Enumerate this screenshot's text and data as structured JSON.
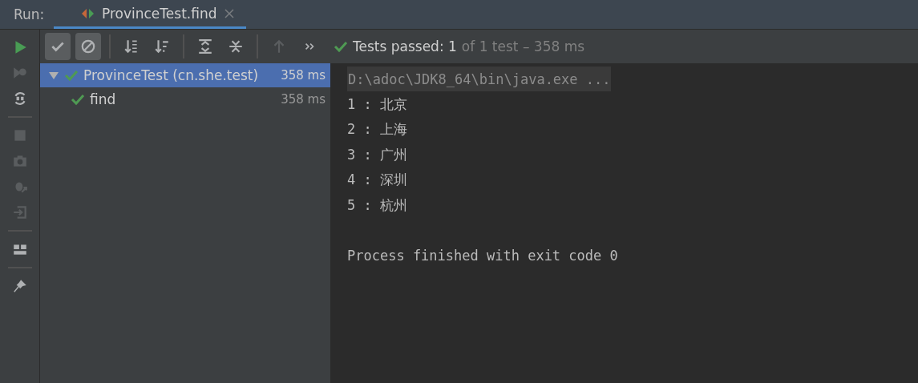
{
  "header": {
    "label": "Run:",
    "tabs": [
      {
        "title": "ProvinceTest.find",
        "selected": true
      }
    ]
  },
  "side_tools": [
    {
      "kind": "run",
      "disabled": false
    },
    {
      "kind": "rerun-failed",
      "disabled": true
    },
    {
      "kind": "toggle-auto",
      "disabled": false
    },
    {
      "kind": "sep"
    },
    {
      "kind": "stop",
      "disabled": true
    },
    {
      "kind": "camera",
      "disabled": true
    },
    {
      "kind": "debug",
      "disabled": true
    },
    {
      "kind": "exit",
      "disabled": true
    },
    {
      "kind": "sep"
    },
    {
      "kind": "layout",
      "disabled": false
    },
    {
      "kind": "sep"
    },
    {
      "kind": "pin",
      "disabled": false
    }
  ],
  "toolbar": [
    {
      "kind": "check",
      "selected": true
    },
    {
      "kind": "ignored",
      "selected": true
    },
    {
      "kind": "sep"
    },
    {
      "kind": "sort-alpha",
      "selected": false
    },
    {
      "kind": "sort-duration",
      "selected": false
    },
    {
      "kind": "sep"
    },
    {
      "kind": "expand",
      "selected": false
    },
    {
      "kind": "collapse",
      "selected": false
    },
    {
      "kind": "sep"
    },
    {
      "kind": "up",
      "selected": false
    },
    {
      "kind": "more",
      "selected": false
    }
  ],
  "status": {
    "label": "Tests passed: 1",
    "detail": "of 1 test – 358 ms"
  },
  "tree": [
    {
      "name": "ProvinceTest (cn.she.test)",
      "time": "358 ms",
      "selected": true,
      "expanded": true,
      "children": [
        {
          "name": "find",
          "time": "358 ms",
          "selected": false
        }
      ]
    }
  ],
  "console": [
    {
      "kind": "command",
      "text": "D:\\adoc\\JDK8_64\\bin\\java.exe ..."
    },
    {
      "kind": "output",
      "text": "1 : 北京"
    },
    {
      "kind": "output",
      "text": "2 : 上海"
    },
    {
      "kind": "output",
      "text": "3 : 广州"
    },
    {
      "kind": "output",
      "text": "4 : 深圳"
    },
    {
      "kind": "output",
      "text": "5 : 杭州"
    },
    {
      "kind": "blank"
    },
    {
      "kind": "output",
      "text": "Process finished with exit code 0"
    }
  ]
}
